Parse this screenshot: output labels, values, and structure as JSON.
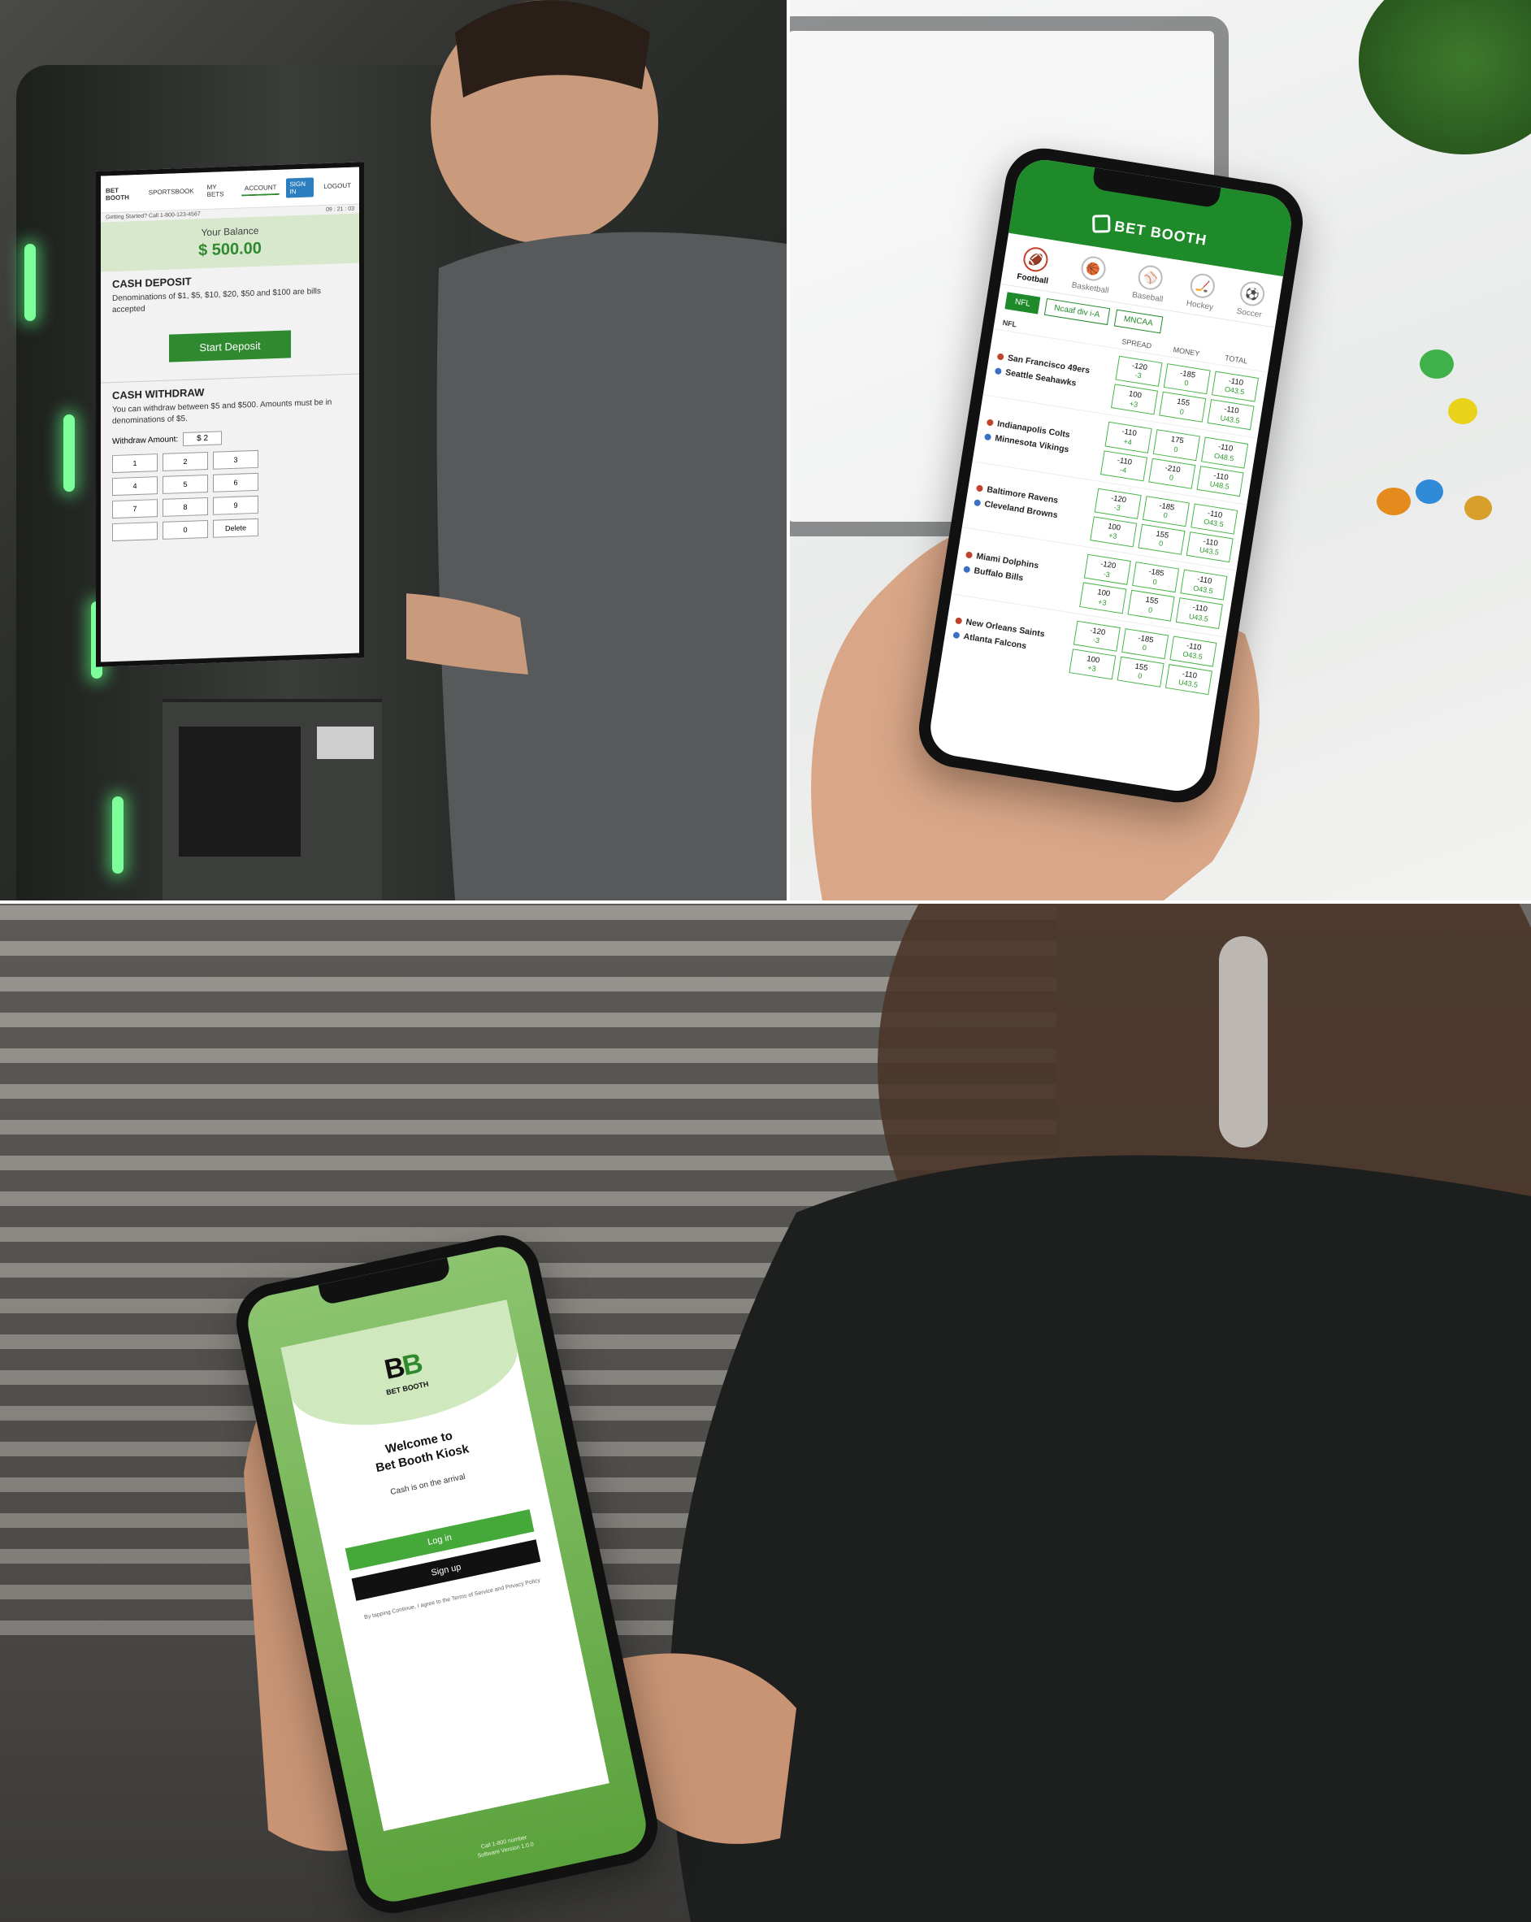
{
  "kiosk": {
    "topbar": "Getting Started? Call 1-800-123-4567",
    "clock": "09 : 21 : 03",
    "brand": "BET BOOTH",
    "tabs": [
      "SPORTSBOOK",
      "MY BETS",
      "ACCOUNT"
    ],
    "actions": [
      "SIGN IN",
      "LOGOUT"
    ],
    "balance_label": "Your Balance",
    "balance_value": "$ 500.00",
    "deposit_title": "CASH DEPOSIT",
    "deposit_text": "Denominations of $1, $5, $10, $20, $50 and $100 are bills accepted",
    "deposit_button": "Start Deposit",
    "withdraw_title": "CASH WITHDRAW",
    "withdraw_text": "You can withdraw between $5 and $500. Amounts must be in denominations of $5.",
    "withdraw_amount_label": "Withdraw Amount:",
    "withdraw_amount_value": "$ 2",
    "keypad": [
      "1",
      "2",
      "3",
      "4",
      "5",
      "6",
      "7",
      "8",
      "9",
      "",
      "0",
      "Delete"
    ]
  },
  "sportsbook": {
    "brand": "BET BOOTH",
    "sports": [
      {
        "label": "Football",
        "icon": "football-icon",
        "glyph": "🏈"
      },
      {
        "label": "Basketball",
        "icon": "basketball-icon",
        "glyph": "🏀"
      },
      {
        "label": "Baseball",
        "icon": "baseball-icon",
        "glyph": "⚾"
      },
      {
        "label": "Hockey",
        "icon": "hockey-icon",
        "glyph": "🏒"
      },
      {
        "label": "Soccer",
        "icon": "soccer-icon",
        "glyph": "⚽"
      }
    ],
    "leagues": [
      "NFL",
      "Ncaaf div i-A",
      "MNCAA"
    ],
    "section": "NFL",
    "columns": [
      "SPREAD",
      "MONEY",
      "TOTAL"
    ],
    "games": [
      {
        "away": "San Francisco 49ers",
        "home": "Seattle Seahawks",
        "spread": [
          [
            "-120",
            "-3"
          ],
          [
            "100",
            "+3"
          ]
        ],
        "money": [
          [
            "-185",
            "0"
          ],
          [
            "155",
            "0"
          ]
        ],
        "total": [
          [
            "-110",
            "O43.5"
          ],
          [
            "-110",
            "U43.5"
          ]
        ]
      },
      {
        "away": "Indianapolis Colts",
        "home": "Minnesota Vikings",
        "spread": [
          [
            "-110",
            "+4"
          ],
          [
            "-110",
            "-4"
          ]
        ],
        "money": [
          [
            "175",
            "0"
          ],
          [
            "-210",
            "0"
          ]
        ],
        "total": [
          [
            "-110",
            "O48.5"
          ],
          [
            "-110",
            "U48.5"
          ]
        ]
      },
      {
        "away": "Baltimore Ravens",
        "home": "Cleveland Browns",
        "spread": [
          [
            "-120",
            "-3"
          ],
          [
            "100",
            "+3"
          ]
        ],
        "money": [
          [
            "-185",
            "0"
          ],
          [
            "155",
            "0"
          ]
        ],
        "total": [
          [
            "-110",
            "O43.5"
          ],
          [
            "-110",
            "U43.5"
          ]
        ]
      },
      {
        "away": "Miami Dolphins",
        "home": "Buffalo Bills",
        "spread": [
          [
            "-120",
            "-3"
          ],
          [
            "100",
            "+3"
          ]
        ],
        "money": [
          [
            "-185",
            "0"
          ],
          [
            "155",
            "0"
          ]
        ],
        "total": [
          [
            "-110",
            "O43.5"
          ],
          [
            "-110",
            "U43.5"
          ]
        ]
      },
      {
        "away": "New Orleans Saints",
        "home": "Atlanta Falcons",
        "spread": [
          [
            "-120",
            "-3"
          ],
          [
            "100",
            "+3"
          ]
        ],
        "money": [
          [
            "-185",
            "0"
          ],
          [
            "155",
            "0"
          ]
        ],
        "total": [
          [
            "-110",
            "O43.5"
          ],
          [
            "-110",
            "U43.5"
          ]
        ]
      }
    ]
  },
  "welcome": {
    "logo_left": "B",
    "logo_right": "B",
    "brand": "BET BOOTH",
    "title_line1": "Welcome to",
    "title_line2": "Bet Booth Kiosk",
    "subtitle": "Cash is on the arrival",
    "login_button": "Log in",
    "signup_button": "Sign up",
    "terms": "By tapping Continue, I agree to the Terms of Service and Privacy Policy",
    "footer_line1": "Call 1-800 number",
    "footer_line2": "Software Version 1.0.0"
  },
  "colors": {
    "brand_green": "#1f8a2a",
    "accent_green": "#45a93a",
    "kiosk_led": "#7dff9a"
  }
}
